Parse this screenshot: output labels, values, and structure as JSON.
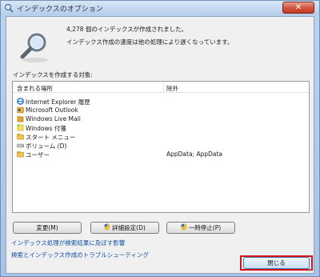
{
  "window": {
    "title": "インデックスのオプション",
    "close_glyph": "✕"
  },
  "status": {
    "count_text": "4,278 個のインデックスが作成されました。",
    "speed_text": "インデックス作成の速度は他の処理により遅くなっています。"
  },
  "locations": {
    "heading": "インデックスを作成する対象:",
    "col_included": "含まれる場所",
    "col_excluded": "除外",
    "items": [
      {
        "name": "Internet Explorer 履歴",
        "excluded": "",
        "icon": "internet-explorer-icon"
      },
      {
        "name": "Microsoft Outlook",
        "excluded": "",
        "icon": "outlook-icon"
      },
      {
        "name": "Windows Live Mail",
        "excluded": "",
        "icon": "live-mail-icon"
      },
      {
        "name": "Windows 付箋",
        "excluded": "",
        "icon": "sticky-notes-icon"
      },
      {
        "name": "スタート メニュー",
        "excluded": "",
        "icon": "folder-icon"
      },
      {
        "name": "ボリューム (D)",
        "excluded": "",
        "icon": "drive-icon"
      },
      {
        "name": "ユーザー",
        "excluded": "AppData; AppData",
        "icon": "folder-icon"
      }
    ]
  },
  "buttons": {
    "modify": "変更(M)",
    "advanced": "詳細設定(D)",
    "pause": "一時停止(P)",
    "close": "閉じる"
  },
  "links": {
    "affects_search": "インデックス処理が検索結果に及ぼす影響",
    "troubleshoot": "検索とインデックス作成のトラブルシューティング"
  },
  "colors": {
    "link": "#0f4fa8",
    "highlight": "#d8101a",
    "close_red": "#c43b24"
  }
}
